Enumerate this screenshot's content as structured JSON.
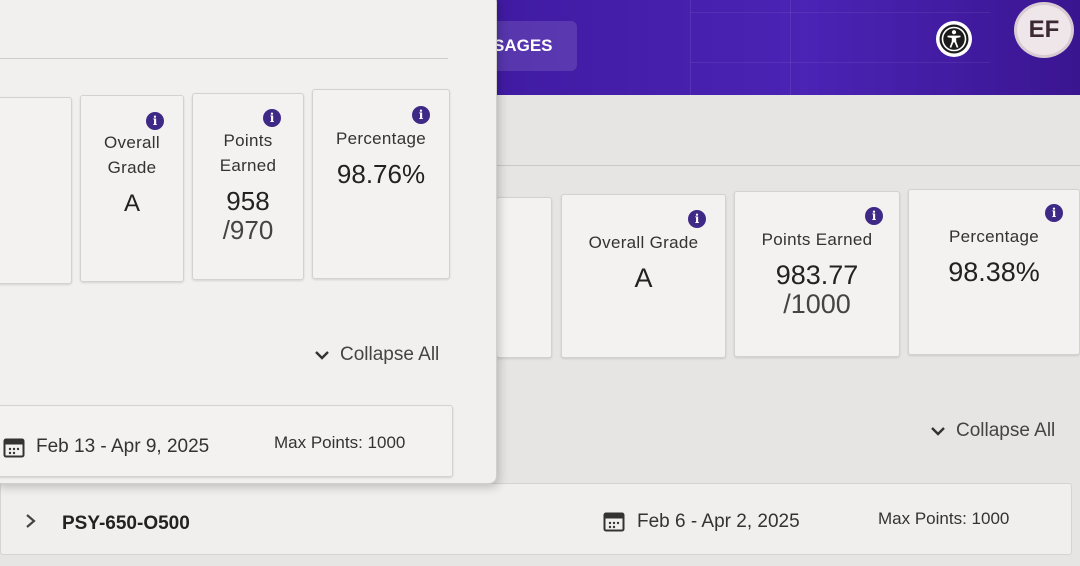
{
  "header": {
    "nav_tab_label": "SAGES",
    "accessibility_icon": "accessibility-icon",
    "avatar_initials": "EF",
    "brand_color": "#4b23b5"
  },
  "back_window": {
    "summary": {
      "overall_grade": {
        "label": "Overall Grade",
        "value": "A"
      },
      "points_earned": {
        "label": "Points Earned",
        "value": "983.77",
        "max": "/1000"
      },
      "percentage": {
        "label": "Percentage",
        "value": "98.38%"
      }
    },
    "collapse_all_label": "Collapse All",
    "course": {
      "code": "PSY-650-O500",
      "dates": "Feb 6 - Apr 2, 2025",
      "max_points": "Max Points: 1000"
    }
  },
  "front_window": {
    "summary": {
      "overall_grade": {
        "label_line1": "Overall",
        "label_line2": "Grade",
        "value": "A"
      },
      "points_earned": {
        "label_line1": "Points",
        "label_line2": "Earned",
        "value": "958",
        "max": "/970"
      },
      "percentage": {
        "label": "Percentage",
        "value": "98.76%"
      }
    },
    "collapse_all_label": "Collapse All",
    "course": {
      "dates": "Feb 13 - Apr 9, 2025",
      "max_points": "Max Points: 1000"
    }
  },
  "info_icon_glyph": "i",
  "colors": {
    "info_icon": "#3e2a86",
    "card_bg": "#f3f2f0",
    "page_bg": "#e6e5e3"
  }
}
